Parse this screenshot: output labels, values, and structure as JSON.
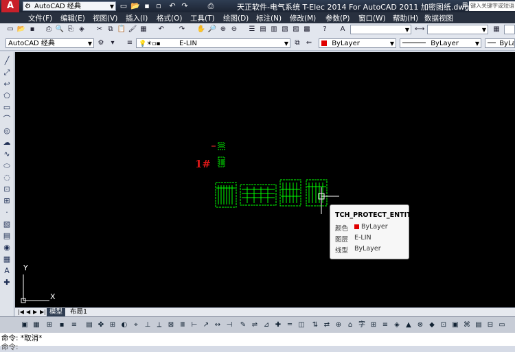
{
  "app": {
    "logo": "A",
    "workspace": "AutoCAD 经典",
    "window_title": "天正软件-电气系统 T-Elec 2014  For AutoCAD 2011    加密图纸.dwg",
    "search_placeholder": "键入关键字或短语"
  },
  "menu": [
    "文件(F)",
    "编辑(E)",
    "视图(V)",
    "插入(I)",
    "格式(O)",
    "工具(T)",
    "绘图(D)",
    "标注(N)",
    "修改(M)",
    "参数(P)",
    "窗口(W)",
    "帮助(H)",
    "数据视图"
  ],
  "toolbar2": {
    "workspace": "AutoCAD 经典",
    "layer": "E-LIN",
    "color": "ByLayer",
    "linetype": "ByLayer",
    "lineweight": "ByLayer"
  },
  "canvas": {
    "label_1": "1#",
    "label_2": "1#",
    "ucs_y": "Y",
    "ucs_x": "X"
  },
  "tooltip": {
    "title": "TCH_PROTECT_ENTITY",
    "color_label": "颜色",
    "color_value": "ByLayer",
    "layer_label": "图层",
    "layer_value": "E-LIN",
    "linetype_label": "线型",
    "linetype_value": "ByLayer"
  },
  "tabs": {
    "model": "模型",
    "layout1": "布局1"
  },
  "command": {
    "line1": "命令: *取消*",
    "line2": "命令:"
  },
  "colors": {
    "canvas": "#000000",
    "drawing": "#00ff00",
    "accent": "#e00000"
  }
}
